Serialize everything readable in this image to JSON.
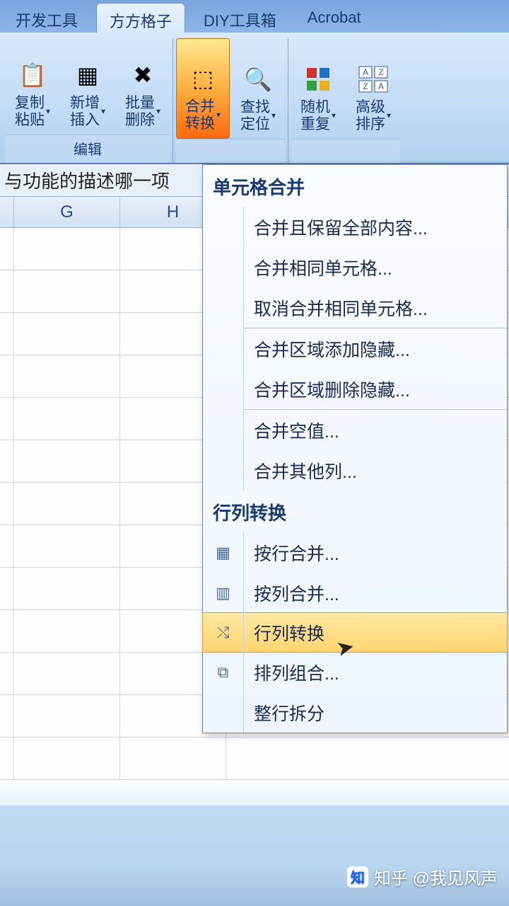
{
  "tabs": {
    "t0": "开发工具",
    "t1": "方方格子",
    "t2": "DIY工具箱",
    "t3": "Acrobat"
  },
  "ribbon": {
    "copy_paste": "复制\n粘贴",
    "new_insert": "新增\n插入",
    "batch_delete": "批量\n删除",
    "merge_convert": "合并\n转换",
    "find_locate": "查找\n定位",
    "random_repeat": "随机\n重复",
    "advanced_sort": "高级\n排序",
    "group_edit": "编辑"
  },
  "formula_text": "与功能的描述哪一项",
  "columns": {
    "g": "G",
    "h": "H"
  },
  "menu": {
    "section1": "单元格合并",
    "i1": "合并且保留全部内容...",
    "i2": "合并相同单元格...",
    "i3": "取消合并相同单元格...",
    "i4": "合并区域添加隐藏...",
    "i5": "合并区域删除隐藏...",
    "i6": "合并空值...",
    "i7": "合并其他列...",
    "section2": "行列转换",
    "i8": "按行合并...",
    "i9": "按列合并...",
    "i10": "行列转换",
    "i11": "排列组合...",
    "i12": "整行拆分"
  },
  "watermark": "知乎 @我见风声"
}
